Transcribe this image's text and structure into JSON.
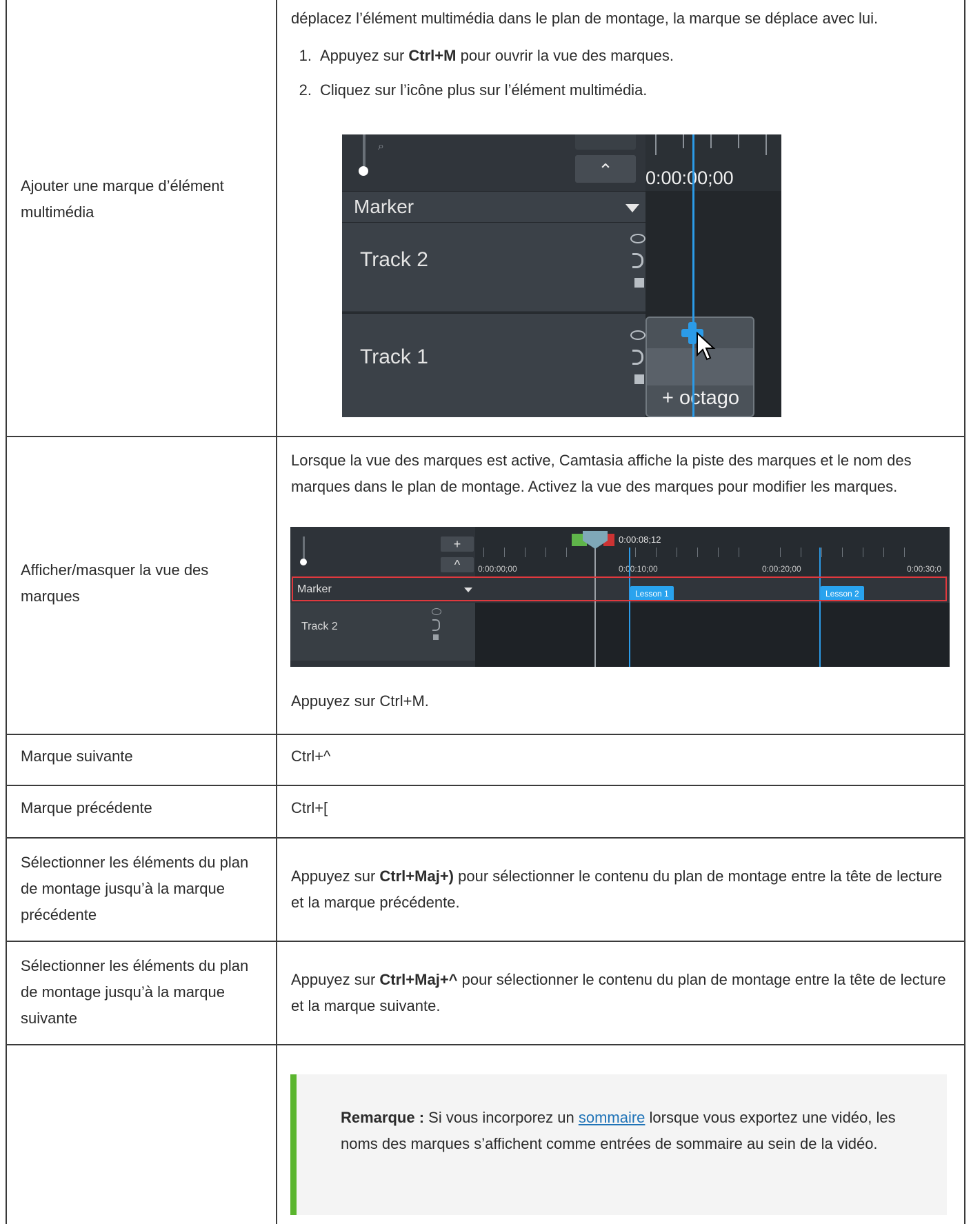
{
  "rows": [
    {
      "label": "Ajouter une marque d’élément multimédia",
      "intro": "déplacez l’élément multimédia dans le plan de montage, la marque se déplace avec lui.",
      "steps": [
        {
          "num": "1.",
          "pre": "Appuyez sur ",
          "bold": "Ctrl+M",
          "post": " pour ouvrir la vue des marques."
        },
        {
          "num": "2.",
          "text": "Cliquez sur l’icône plus sur l’élément multimédia."
        }
      ],
      "screenshot": {
        "time": "0:00:00;00",
        "marker_label": "Marker",
        "tracks": [
          "Track 2",
          "Track 1"
        ],
        "clip_label": "+ octago"
      }
    },
    {
      "label": "Afficher/masquer la vue des marques",
      "description": "Lorsque la vue des marques est active, Camtasia affiche la piste des marques et le nom des marques dans le plan de montage. Activez la vue des marques pour modifier les marques.",
      "screenshot": {
        "playhead_time": "0:00:08;12",
        "ruler_times": [
          "0:00:00;00",
          "0:00:10;00",
          "0:00:20;00",
          "0:00:30;0"
        ],
        "marker_label": "Marker",
        "track_label": "Track 2",
        "lessons": [
          "Lesson 1",
          "Lesson 2"
        ],
        "plus_symbol": "+",
        "up_symbol": "^"
      },
      "footer": "Appuyez sur Ctrl+M."
    },
    {
      "label": "Marque suivante",
      "value": "Ctrl+^"
    },
    {
      "label": "Marque précédente",
      "value": "Ctrl+["
    },
    {
      "label": "Sélectionner les éléments du plan de montage jusqu’à la marque précédente",
      "pre": "Appuyez sur ",
      "bold": "Ctrl+Maj+)",
      "post": " pour sélectionner le contenu du plan de montage entre la tête de lecture et la marque précédente."
    },
    {
      "label": "Sélectionner les éléments du plan de montage jusqu’à la marque suivante",
      "pre": "Appuyez sur ",
      "bold": "Ctrl+Maj+^",
      "post": " pour sélectionner le contenu du plan de montage entre la tête de lecture et la marque suivante."
    }
  ],
  "note": {
    "bold": "Remarque :",
    "pre": " Si vous incorporez un ",
    "link": "sommaire",
    "post": " lorsque vous exportez une vidéo, les noms des marques s’affichent comme entrées de sommaire au sein de la vidéo."
  },
  "colors": {
    "border": "#3a3a3a",
    "note_accent": "#5ab52e",
    "link": "#1f73b7",
    "playhead_blue": "#2b9be8",
    "highlight_red": "#e0393e"
  }
}
